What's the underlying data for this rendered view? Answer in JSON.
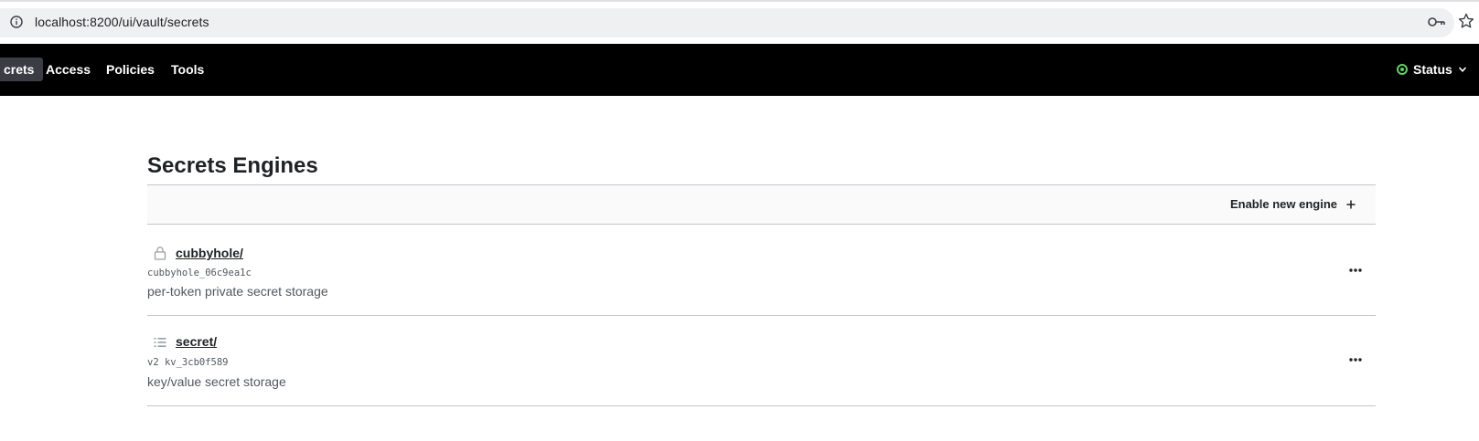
{
  "browser": {
    "url": "localhost:8200/ui/vault/secrets",
    "icons": {
      "info": "info-icon",
      "key": "key-icon",
      "bookmark": "star-icon"
    }
  },
  "nav": {
    "items": [
      {
        "label": "crets",
        "active": true
      },
      {
        "label": "Access",
        "active": false
      },
      {
        "label": "Policies",
        "active": false
      },
      {
        "label": "Tools",
        "active": false
      }
    ],
    "status_label": "Status",
    "status_color": "#5fd35f"
  },
  "main": {
    "title": "Secrets Engines",
    "enable_label": "Enable new engine",
    "engines": [
      {
        "icon": "lock-icon",
        "path": "cubbyhole/",
        "accessor": "cubbyhole_06c9ea1c",
        "description": "per-token private secret storage"
      },
      {
        "icon": "list-icon",
        "path": "secret/",
        "accessor": "v2 kv_3cb0f589",
        "description": "key/value secret storage"
      }
    ]
  }
}
